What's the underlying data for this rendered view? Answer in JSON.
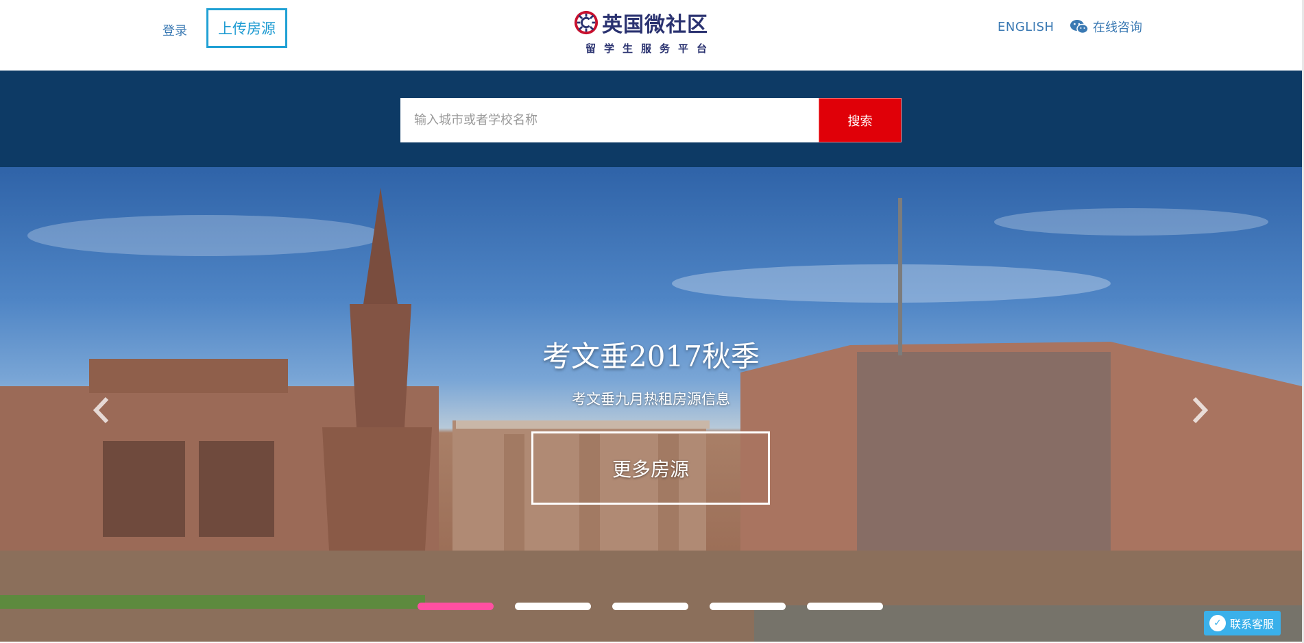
{
  "header": {
    "login_label": "登录",
    "upload_label": "上传房源",
    "logo_name": "英国微社区",
    "logo_subtitle": "留学生服务平台",
    "english_label": "ENGLISH",
    "consult_label": "在线咨询"
  },
  "search": {
    "placeholder": "输入城市或者学校名称",
    "value": "",
    "button_label": "搜索"
  },
  "hero": {
    "title": "考文垂2017秋季",
    "subtitle": "考文垂九月热租房源信息",
    "button_label": "更多房源",
    "slides_count": 5,
    "active_slide": 1
  },
  "service": {
    "label": "联系客服"
  },
  "colors": {
    "search_band": "#0d3a65",
    "search_button": "#e00008",
    "upload_border": "#1fa0d4",
    "indicator_active": "#ff4fa2",
    "service_button": "#3ab0ea",
    "link": "#3a79b3"
  }
}
